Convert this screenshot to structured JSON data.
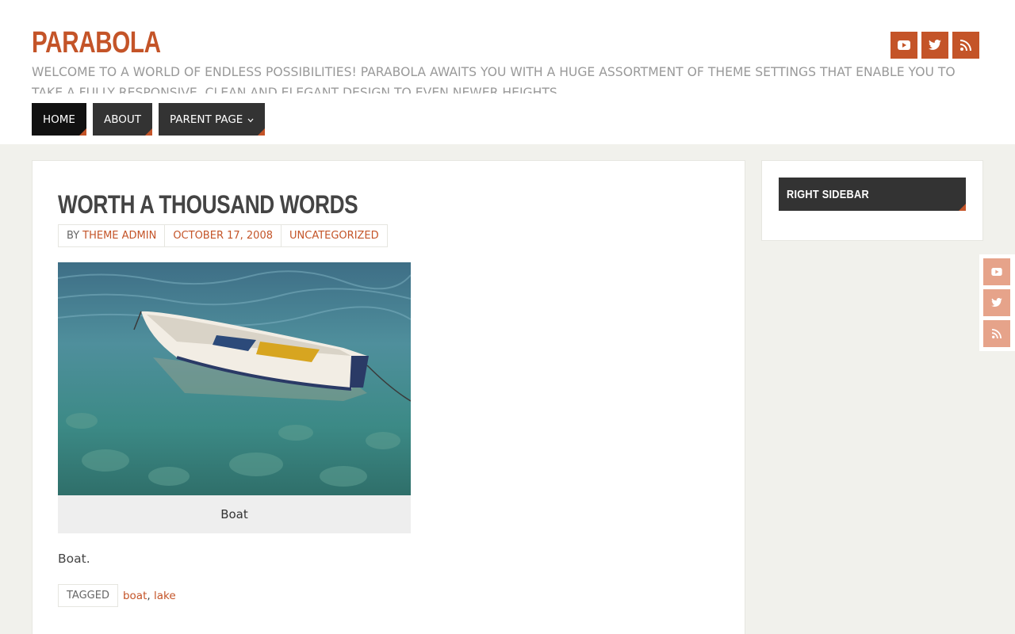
{
  "site": {
    "title": "PARABOLA",
    "description": "WELCOME TO A WORLD OF ENDLESS POSSIBILITIES! PARABOLA AWAITS YOU WITH A HUGE ASSORTMENT OF THEME SETTINGS THAT ENABLE YOU TO TAKE A FULLY RESPONSIVE, CLEAN AND ELEGANT DESIGN TO EVEN NEWER HEIGHTS."
  },
  "social": {
    "icons": [
      "youtube-icon",
      "twitter-icon",
      "rss-icon"
    ]
  },
  "nav": {
    "home": "HOME",
    "about": "ABOUT",
    "parent": "PARENT PAGE"
  },
  "post": {
    "title": "WORTH A THOUSAND WORDS",
    "by_label": "BY",
    "author": "THEME ADMIN",
    "date": "OCTOBER 17, 2008",
    "category": "UNCATEGORIZED",
    "caption": "Boat",
    "text": "Boat.",
    "tagged_label": "TAGGED",
    "tags": [
      "boat",
      "lake"
    ],
    "tag_separator": ","
  },
  "sidebar": {
    "widget_title": "RIGHT SIDEBAR"
  },
  "colors": {
    "accent": "#c45428",
    "accent_light": "#e6a38a",
    "dark": "#333333",
    "background": "#f1f1ec"
  }
}
